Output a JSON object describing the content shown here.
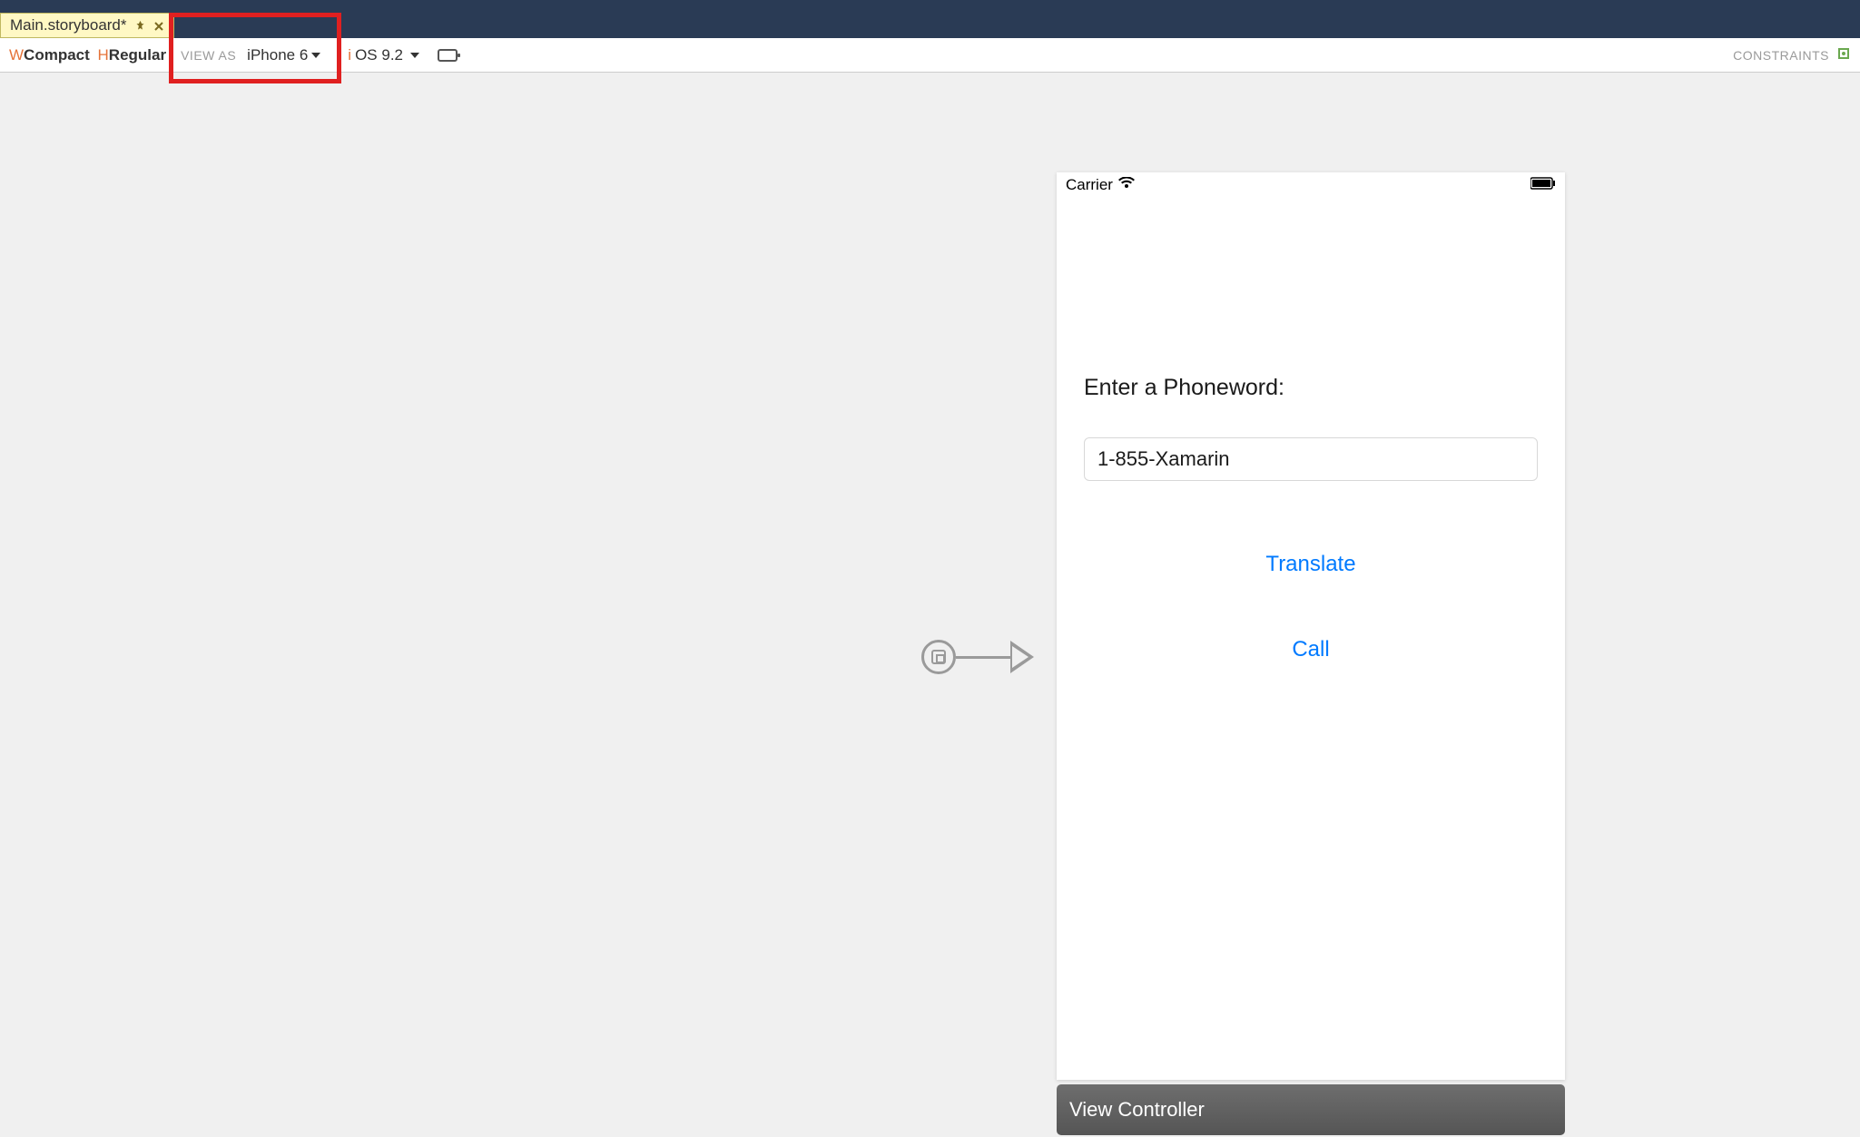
{
  "tab": {
    "title": "Main.storyboard*"
  },
  "toolbar": {
    "sizeclass_w_prefix": "W",
    "sizeclass_w_value": "Compact",
    "sizeclass_h_prefix": "H",
    "sizeclass_h_value": "Regular",
    "view_as_label": "VIEW AS",
    "device": "iPhone 6",
    "ios_prefix": "i",
    "ios_version": "OS 9.2",
    "constraints_label": "CONSTRAINTS"
  },
  "device": {
    "carrier": "Carrier",
    "label": "Enter a Phoneword:",
    "input_value": "1-855-Xamarin",
    "translate_label": "Translate",
    "call_label": "Call"
  },
  "vc_bar": {
    "label": "View Controller"
  }
}
